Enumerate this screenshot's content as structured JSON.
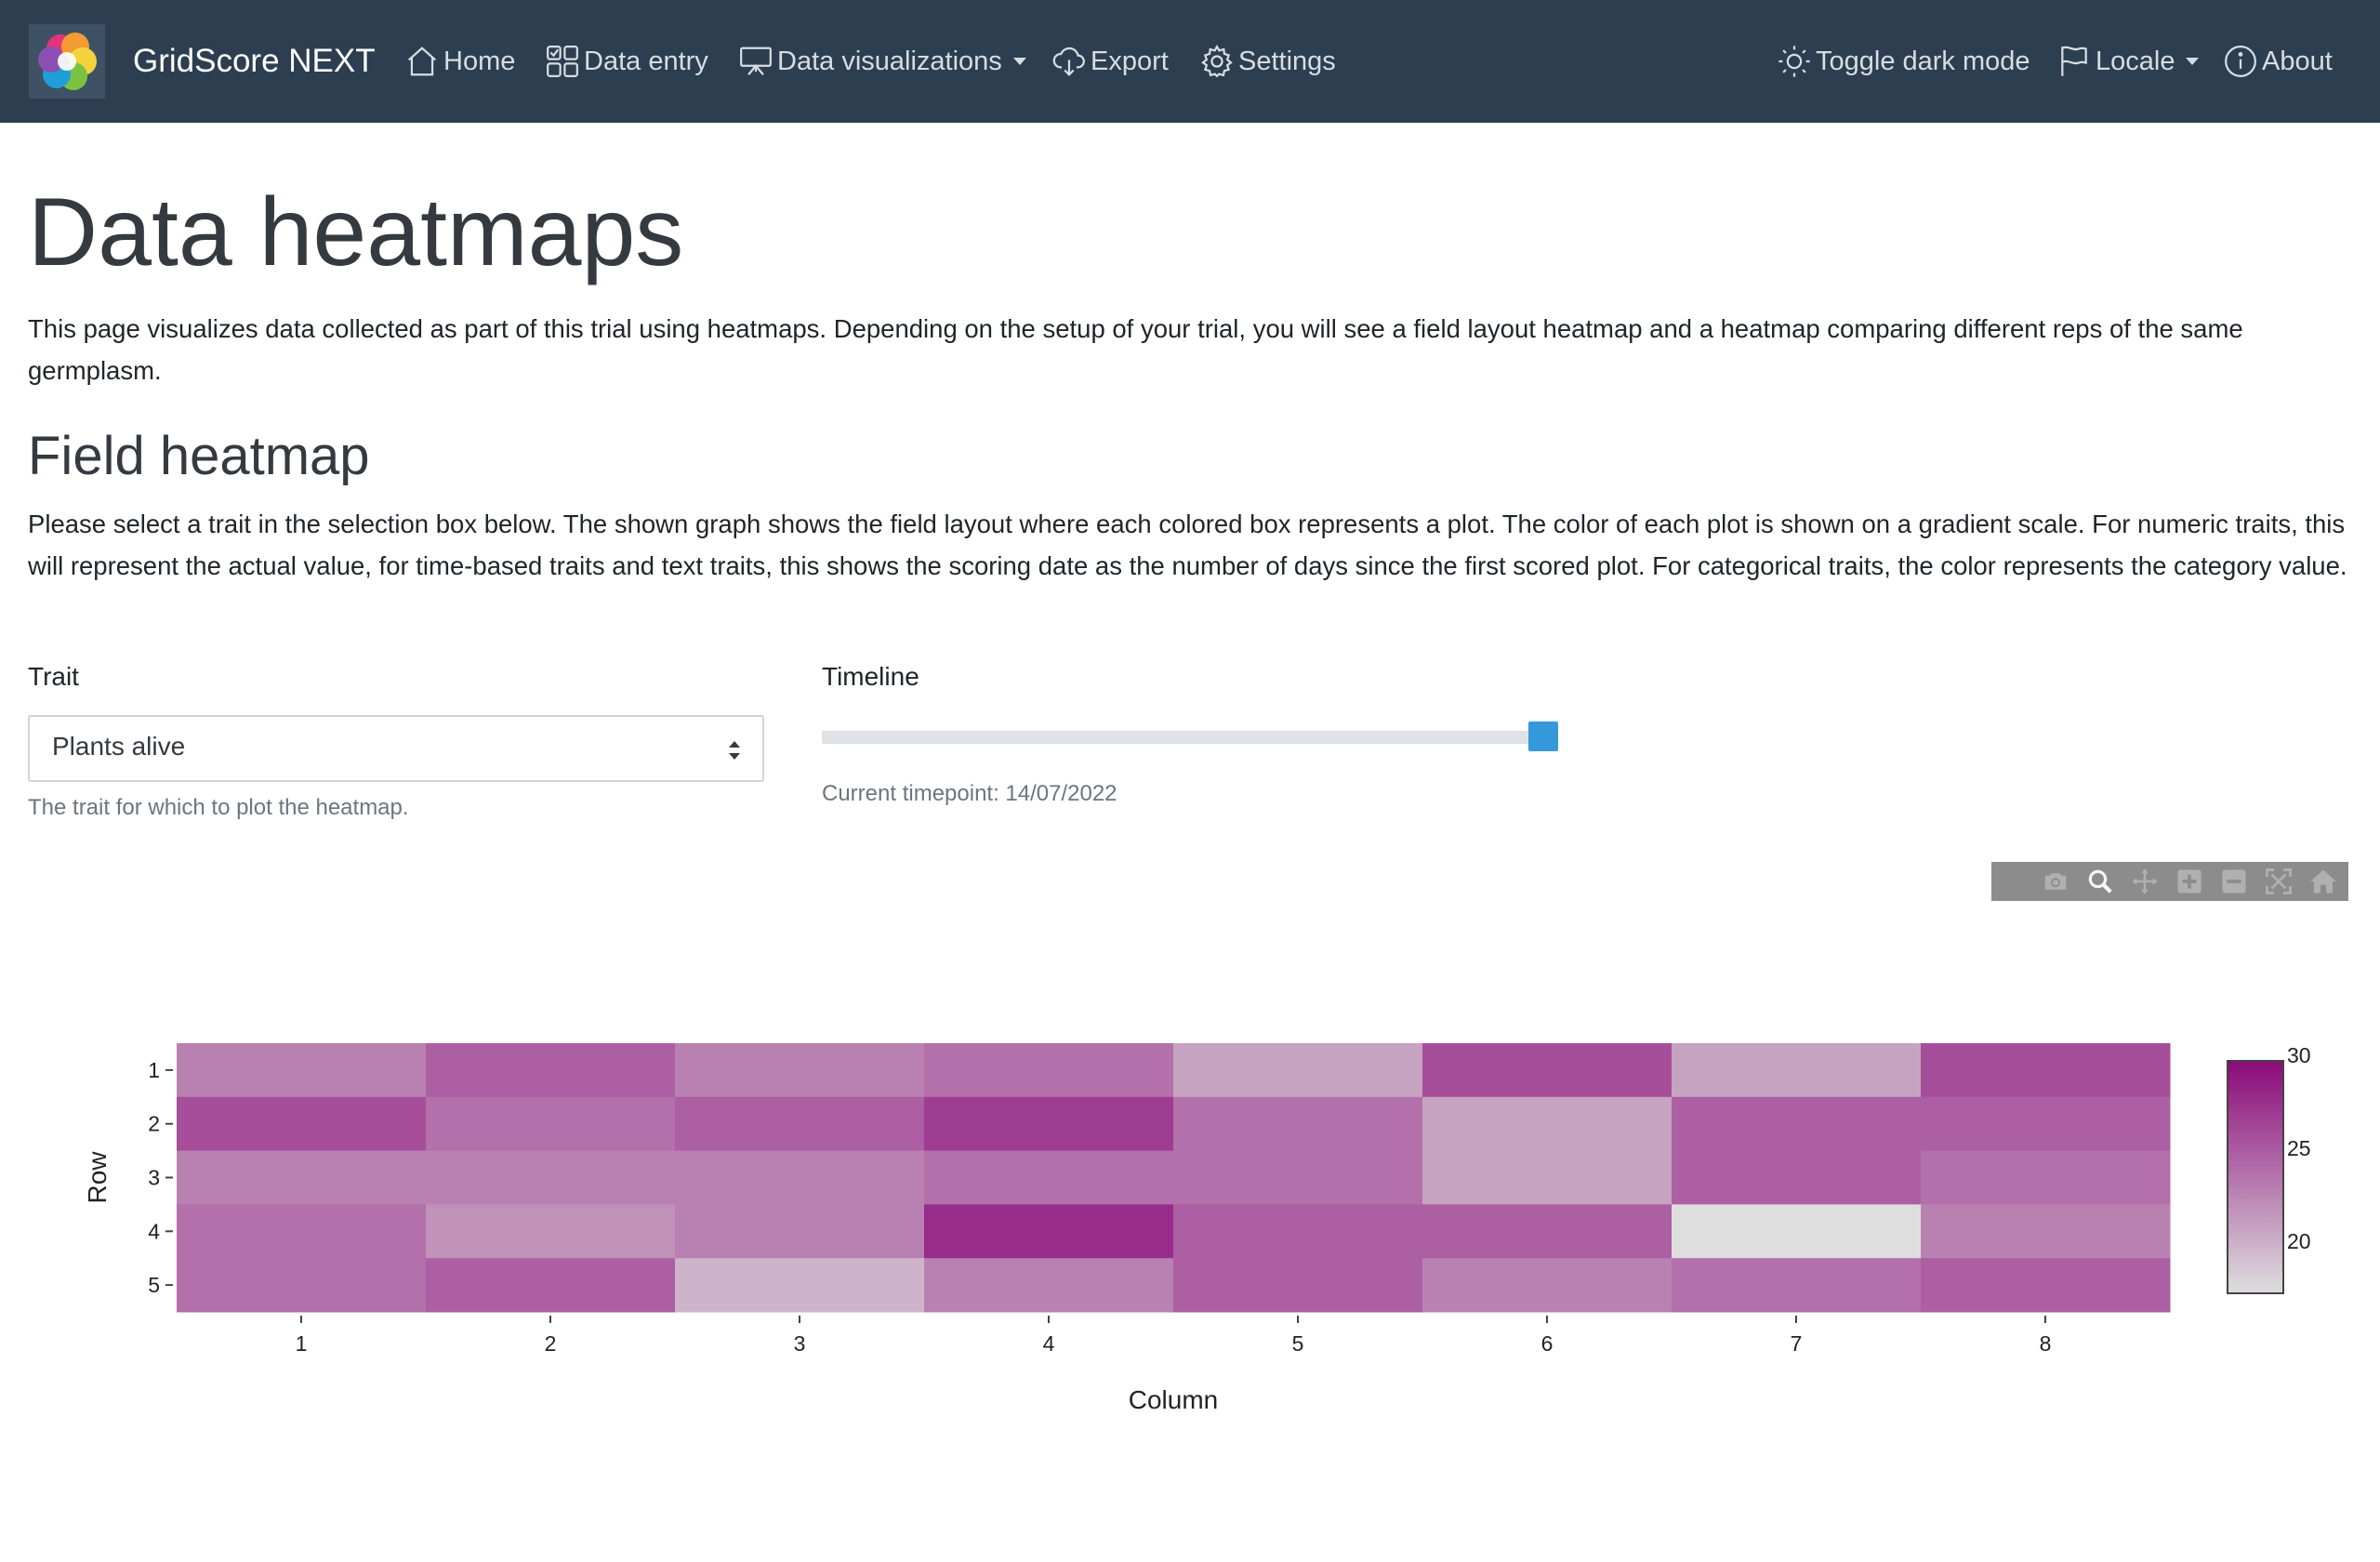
{
  "navbar": {
    "brand": "GridScore NEXT",
    "items": [
      {
        "label": "Home",
        "icon": "house-icon"
      },
      {
        "label": "Data entry",
        "icon": "grid-icon"
      },
      {
        "label": "Data visualizations",
        "icon": "easel-icon",
        "dropdown": true
      },
      {
        "label": "Export",
        "icon": "cloud-download-icon"
      },
      {
        "label": "Settings",
        "icon": "gear-icon"
      },
      {
        "label": "Toggle dark mode",
        "icon": "sun-icon"
      },
      {
        "label": "Locale",
        "icon": "flag-icon",
        "dropdown": true
      },
      {
        "label": "About",
        "icon": "info-icon"
      }
    ],
    "background": "#2c3e50"
  },
  "page": {
    "title": "Data heatmaps",
    "intro": "This page visualizes data collected as part of this trial using heatmaps. Depending on the setup of your trial, you will see a field layout heatmap and a heatmap comparing different reps of the same germplasm.",
    "field_heading": "Field heatmap",
    "field_description": "Please select a trait in the selection box below. The shown graph shows the field layout where each colored box represents a plot. The color of each plot is shown on a gradient scale. For numeric traits, this will represent the actual value, for time-based traits and text traits, this shows the scoring date as the number of days since the first scored plot. For categorical traits, the color represents the category value."
  },
  "trait": {
    "label": "Trait",
    "selected": "Plants alive",
    "help": "The trait for which to plot the heatmap."
  },
  "timeline": {
    "label": "Timeline",
    "current": "Current timepoint: 14/07/2022",
    "position": 1.0,
    "accent": "#3498db"
  },
  "modebar": {
    "icons": [
      "camera-icon",
      "zoom-icon",
      "pan-icon",
      "zoom-in-icon",
      "zoom-out-icon",
      "autoscale-icon",
      "reset-axes-icon"
    ]
  },
  "chart_data": {
    "type": "heatmap",
    "xlabel": "Column",
    "ylabel": "Row",
    "x": [
      1,
      2,
      3,
      4,
      5,
      6,
      7,
      8
    ],
    "y": [
      1,
      2,
      3,
      4,
      5
    ],
    "z": [
      [
        23,
        25,
        23,
        24,
        21,
        26,
        21,
        26
      ],
      [
        26,
        24,
        25,
        27,
        24,
        21,
        25,
        25
      ],
      [
        23,
        23,
        23,
        24,
        24,
        21,
        25,
        24
      ],
      [
        24,
        22,
        23,
        28,
        25,
        25,
        17.5,
        23
      ],
      [
        24,
        25,
        20,
        23,
        25,
        23,
        24,
        25
      ]
    ],
    "zmin": 17.5,
    "zmax": 30,
    "colorbar_ticks": [
      20,
      25,
      30
    ],
    "colorscale": [
      "#dedede",
      "#8b0a7a"
    ]
  }
}
